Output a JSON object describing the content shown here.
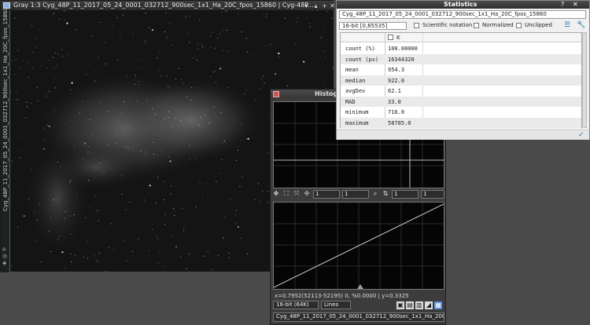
{
  "image_window": {
    "title": "Gray 1:3 Cyg_48P_11_2017_05_24_0001_032712_900sec_1x1_Ha_20C_fpos_15860 | Cyg-48P...",
    "side_label": "Cyg_48P_11_2017_05_24_0001_032712_900sec_1x1_Ha_20C_fpos_15860",
    "buttons": [
      "▾",
      "▴",
      "+",
      "✕"
    ]
  },
  "statistics": {
    "title": "Statistics",
    "view_selector": "Cyg_48P_11_2017_05_24_0001_032712_900sec_1x1_Ha_20C_fpos_15860",
    "range_selector": "16-bit [0,65535]",
    "options": [
      {
        "label": "Scientific notation",
        "checked": false
      },
      {
        "label": "Normalized",
        "checked": false
      },
      {
        "label": "Unclipped",
        "checked": false
      }
    ],
    "column_header": "K",
    "rows": [
      {
        "label": "count (%)",
        "value": "100.00000"
      },
      {
        "label": "count (px)",
        "value": "16344320"
      },
      {
        "label": "mean",
        "value": "954.3"
      },
      {
        "label": "median",
        "value": "922.0"
      },
      {
        "label": "avgDev",
        "value": "62.1"
      },
      {
        "label": "MAD",
        "value": "33.0"
      },
      {
        "label": "minimum",
        "value": "716.0"
      },
      {
        "label": "maximum",
        "value": "58785.0"
      }
    ]
  },
  "histogram": {
    "title": "Histog",
    "toolbar_values": [
      "1",
      "1",
      "1",
      "1"
    ],
    "status": "x=0.7952(52113-52195) 0, %0.0000 | y=0.3325",
    "resolution": "16-bit (64K)",
    "mode": "Lines",
    "view_selector": "Cyg_48P_11_2017_05_24_0001_032712_900sec_1x1_Ha_20C..."
  },
  "colors": {
    "workspace": "#4a4a4a",
    "accent_green": "#2b7a4b",
    "stats_bg": "#f0f0f0",
    "link_blue": "#2a6fc9"
  }
}
